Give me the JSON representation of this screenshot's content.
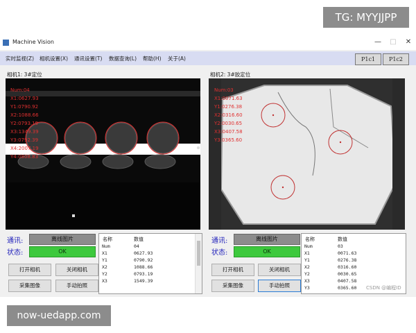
{
  "overlay": {
    "top_tag": "TG: MYYJJPP",
    "bottom_tag": "now-uedapp.com",
    "watermark": "CSDN @编程ID"
  },
  "window": {
    "title": "Machine Vision",
    "controls": {
      "minimize": "—",
      "maximize": "□",
      "close": "✕"
    }
  },
  "menu": {
    "items": [
      "实时监视(Z)",
      "相机设置(X)",
      "通讯设置(T)",
      "数据查询(L)",
      "帮助(H)",
      "关于(A)"
    ],
    "plc": [
      "P1c1",
      "P1c2"
    ]
  },
  "camera1": {
    "label": "相机1:  3#定位",
    "overlay": [
      "Num:04",
      "X1:0627.93",
      "Y1:0790.92",
      "X2:1088.66",
      "Y2:0793.19",
      "X3:1349.39",
      "Y3:0792.39",
      "X4:2007.19",
      "Y4:0808.83"
    ],
    "comm_label": "通讯:",
    "comm_value": "离线图片",
    "status_label": "状态:",
    "status_value": "OK",
    "buttons": {
      "open": "打开相机",
      "close": "关闭相机",
      "capture": "采集图像",
      "manual": "手动拍照"
    },
    "table": {
      "headers": [
        "名称",
        "数值"
      ],
      "rows": [
        [
          "Num",
          "04"
        ],
        [
          "X1",
          "0627.93"
        ],
        [
          "Y1",
          "0790.92"
        ],
        [
          "X2",
          "1088.66"
        ],
        [
          "Y2",
          "0793.19"
        ],
        [
          "X3",
          "1549.39"
        ]
      ]
    }
  },
  "camera2": {
    "label": "相机2:  3#胶定位",
    "overlay": [
      "Num:03",
      "X1:0071.63",
      "Y1:0276.38",
      "X2:0316.60",
      "Y2:0030.65",
      "X3:0407.58",
      "Y3:0365.60"
    ],
    "comm_label": "通讯:",
    "comm_value": "离线图片",
    "status_label": "状态:",
    "status_value": "OK",
    "buttons": {
      "open": "打开相机",
      "close": "关闭相机",
      "capture": "采集图像",
      "manual": "手动拍照"
    },
    "table": {
      "headers": [
        "名称",
        "数值"
      ],
      "rows": [
        [
          "Num",
          "03"
        ],
        [
          "X1",
          "0071.63"
        ],
        [
          "Y1",
          "0276.38"
        ],
        [
          "X2",
          "0316.60"
        ],
        [
          "Y2",
          "0030.65"
        ],
        [
          "X3",
          "0407.58"
        ],
        [
          "Y3",
          "0365.60"
        ]
      ]
    }
  },
  "colors": {
    "menu_bg": "#d8dcf2",
    "comm_box": "#8c8c8c",
    "status_ok": "#3dc93d",
    "overlay_red": "#e03030",
    "label_blue": "#2222bb"
  }
}
